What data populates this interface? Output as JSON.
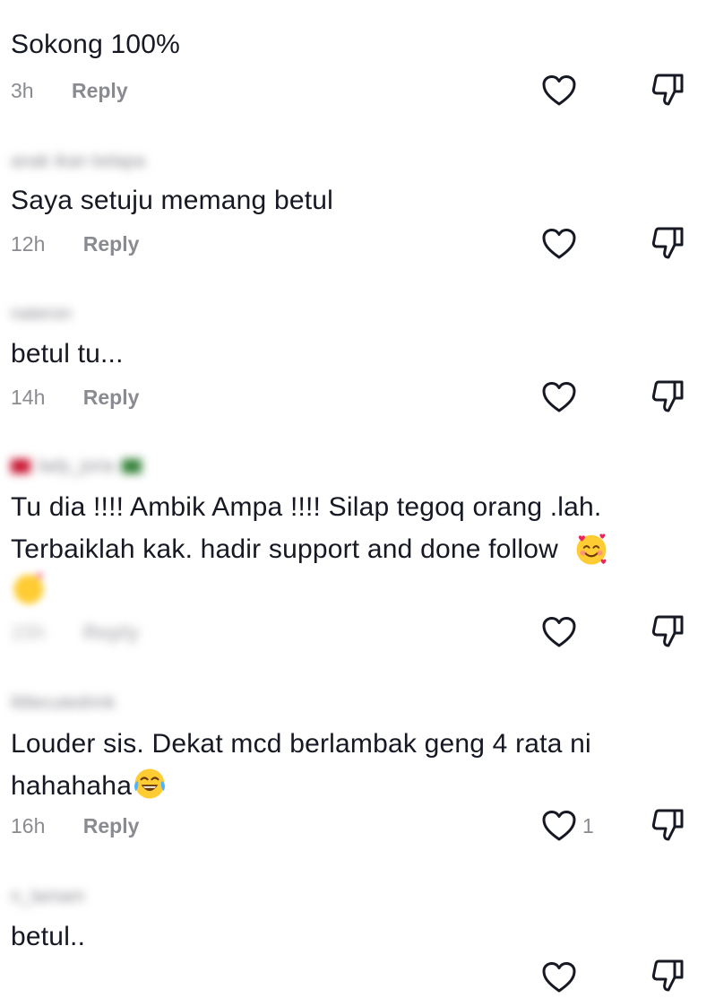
{
  "reply_label": "Reply",
  "comments": [
    {
      "username": "",
      "text": "Sokong 100%",
      "time": "3h",
      "reply": "Reply",
      "likes": ""
    },
    {
      "username": "anak ikan kelapa",
      "text": "Saya setuju memang betul",
      "time": "12h",
      "reply": "Reply",
      "likes": ""
    },
    {
      "username": "nateron",
      "text": "betul tu...",
      "time": "14h",
      "reply": "Reply",
      "likes": ""
    },
    {
      "username": "lady_joria",
      "text_line1": "Tu dia !!!! Ambik Ampa !!!! Silap tegoq orang .lah.",
      "text_line2": "Terbaiklah kak. hadir support and done follow",
      "time": "15h",
      "reply": "Reply",
      "likes": ""
    },
    {
      "username": "littlecutedrink",
      "text_line1": "Louder sis. Dekat mcd berlambak geng 4 rata ni",
      "text_line2": "hahahaha",
      "time": "16h",
      "reply": "Reply",
      "likes": "1"
    },
    {
      "username": "n_lamam",
      "text": "betul..",
      "time": "",
      "reply": "",
      "likes": ""
    }
  ],
  "icons": {
    "like": "heart-outline-icon",
    "dislike": "thumbs-down-outline-icon",
    "emoji_smiling_hearts": "smiling-face-with-hearts-emoji",
    "emoji_tears_of_joy": "face-with-tears-of-joy-emoji"
  },
  "colors": {
    "text": "#161823",
    "meta": "#8a8b91",
    "icon": "#161823",
    "background": "#ffffff"
  }
}
